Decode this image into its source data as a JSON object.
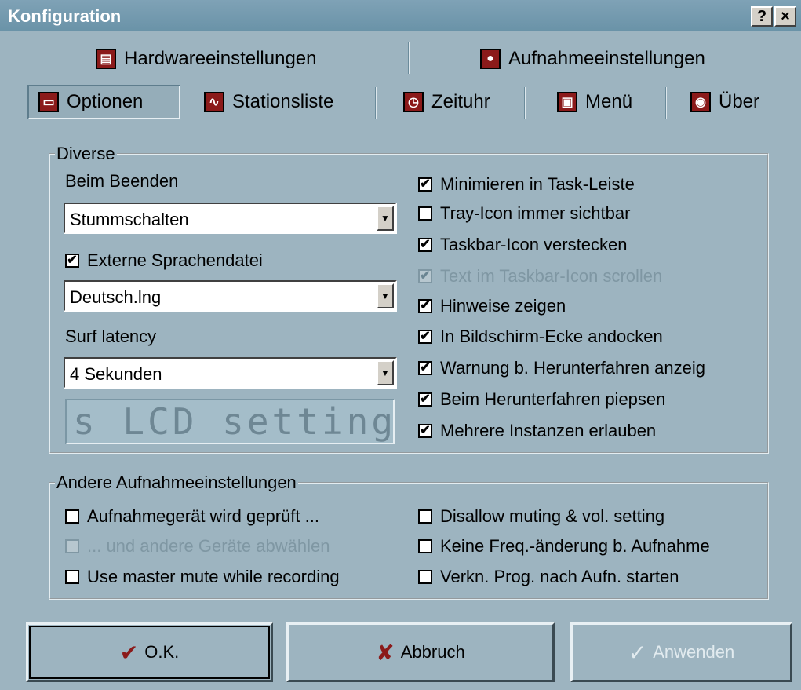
{
  "window": {
    "title": "Konfiguration",
    "help_button": "?",
    "close_button": "×"
  },
  "tabs_row1": [
    {
      "label": "Hardwareeinstellungen",
      "icon": "hardware-icon"
    },
    {
      "label": "Aufnahmeeinstellungen",
      "icon": "record-icon"
    }
  ],
  "tabs_row2": [
    {
      "label": "Optionen",
      "icon": "options-icon",
      "active": true
    },
    {
      "label": "Stationsliste",
      "icon": "stationlist-icon"
    },
    {
      "label": "Zeituhr",
      "icon": "clock-icon"
    },
    {
      "label": "Menü",
      "icon": "menu-icon"
    },
    {
      "label": "Über",
      "icon": "about-icon"
    }
  ],
  "diverse": {
    "legend": "Diverse",
    "beim_beenden_label": "Beim Beenden",
    "beim_beenden_value": "Stummschalten",
    "externe_sprachdatei": {
      "label": "Externe Sprachendatei",
      "checked": true
    },
    "sprachdatei_value": "Deutsch.lng",
    "surf_latency_label": "Surf latency",
    "surf_latency_value": "4 Sekunden",
    "lcd_text": "s LCD setting",
    "options": [
      {
        "label": "Minimieren in Task-Leiste",
        "checked": true
      },
      {
        "label": "Tray-Icon immer sichtbar",
        "checked": false
      },
      {
        "label": "Taskbar-Icon verstecken",
        "checked": true
      },
      {
        "label": "Text im Taskbar-Icon scrollen",
        "checked": true,
        "disabled": true
      },
      {
        "label": "Hinweise zeigen",
        "checked": true
      },
      {
        "label": "In Bildschirm-Ecke andocken",
        "checked": true
      },
      {
        "label": "Warnung b. Herunterfahren anzeig",
        "checked": true
      },
      {
        "label": "Beim Herunterfahren piepsen",
        "checked": true
      },
      {
        "label": "Mehrere Instanzen erlauben",
        "checked": true
      }
    ]
  },
  "andere": {
    "legend": "Andere Aufnahmeeinstellungen",
    "left": [
      {
        "label": "Aufnahmegerät wird geprüft ...",
        "checked": false
      },
      {
        "label": "... und andere Geräte abwählen",
        "checked": false,
        "disabled": true
      },
      {
        "label": "Use master mute while recording",
        "checked": false
      }
    ],
    "right": [
      {
        "label": "Disallow muting & vol. setting",
        "checked": false
      },
      {
        "label": "Keine Freq.-änderung b. Aufnahme",
        "checked": false
      },
      {
        "label": "Verkn. Prog. nach Aufn. starten",
        "checked": false
      }
    ]
  },
  "buttons": {
    "ok": "O.K.",
    "cancel": "Abbruch",
    "apply": "Anwenden"
  }
}
